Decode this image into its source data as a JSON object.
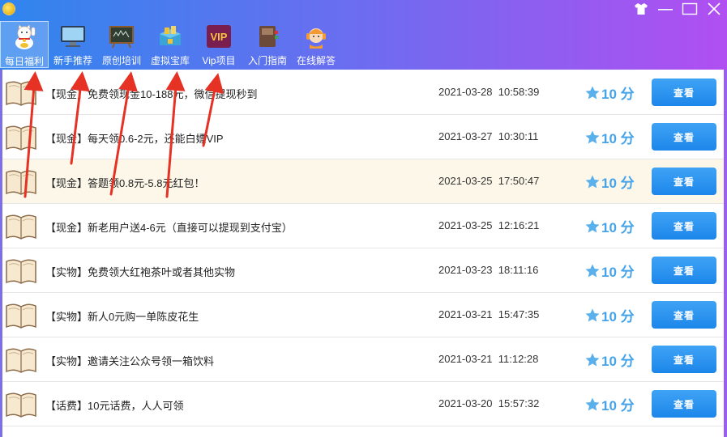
{
  "toolbar": {
    "items": [
      {
        "label": "每日福利",
        "icon": "lucky-cat-icon"
      },
      {
        "label": "新手推荐",
        "icon": "monitor-icon"
      },
      {
        "label": "原创培训",
        "icon": "blackboard-icon"
      },
      {
        "label": "虚拟宝库",
        "icon": "treasure-box-icon"
      },
      {
        "label": "Vip项目",
        "icon": "vip-badge-icon",
        "badge": "VIP"
      },
      {
        "label": "入门指南",
        "icon": "guide-book-icon"
      },
      {
        "label": "在线解答",
        "icon": "customer-service-icon"
      }
    ]
  },
  "list": {
    "button_label": "查看",
    "rows": [
      {
        "title": "【现金】免费领现金10-188元，微信提现秒到",
        "date": "2021-03-28",
        "time": "10:58:39",
        "score": "10 分"
      },
      {
        "title": "【现金】每天领0.6-2元，还能白嫖VIP",
        "date": "2021-03-27",
        "time": "10:30:11",
        "score": "10 分"
      },
      {
        "title": "【现金】答题领0.8元-5.8元红包！",
        "date": "2021-03-25",
        "time": "17:50:47",
        "score": "10 分"
      },
      {
        "title": "【现金】新老用户送4-6元（直接可以提现到支付宝）",
        "date": "2021-03-25",
        "time": "12:16:21",
        "score": "10 分"
      },
      {
        "title": "【实物】免费领大红袍茶叶或者其他实物",
        "date": "2021-03-23",
        "time": "18:11:16",
        "score": "10 分"
      },
      {
        "title": "【实物】新人0元购一单陈皮花生",
        "date": "2021-03-21",
        "time": "15:47:35",
        "score": "10 分"
      },
      {
        "title": "【实物】邀请关注公众号领一箱饮料",
        "date": "2021-03-21",
        "time": "11:12:28",
        "score": "10 分"
      },
      {
        "title": "【话费】10元话费，人人可领",
        "date": "2021-03-20",
        "time": "15:57:32",
        "score": "10 分"
      }
    ]
  },
  "colors": {
    "header_start": "#2f86ee",
    "header_end": "#b14ff1",
    "button": "#1c86ea",
    "score": "#45a3ea",
    "annotation_arrow": "#e53224",
    "highlight_row": "#fdf7e9"
  }
}
